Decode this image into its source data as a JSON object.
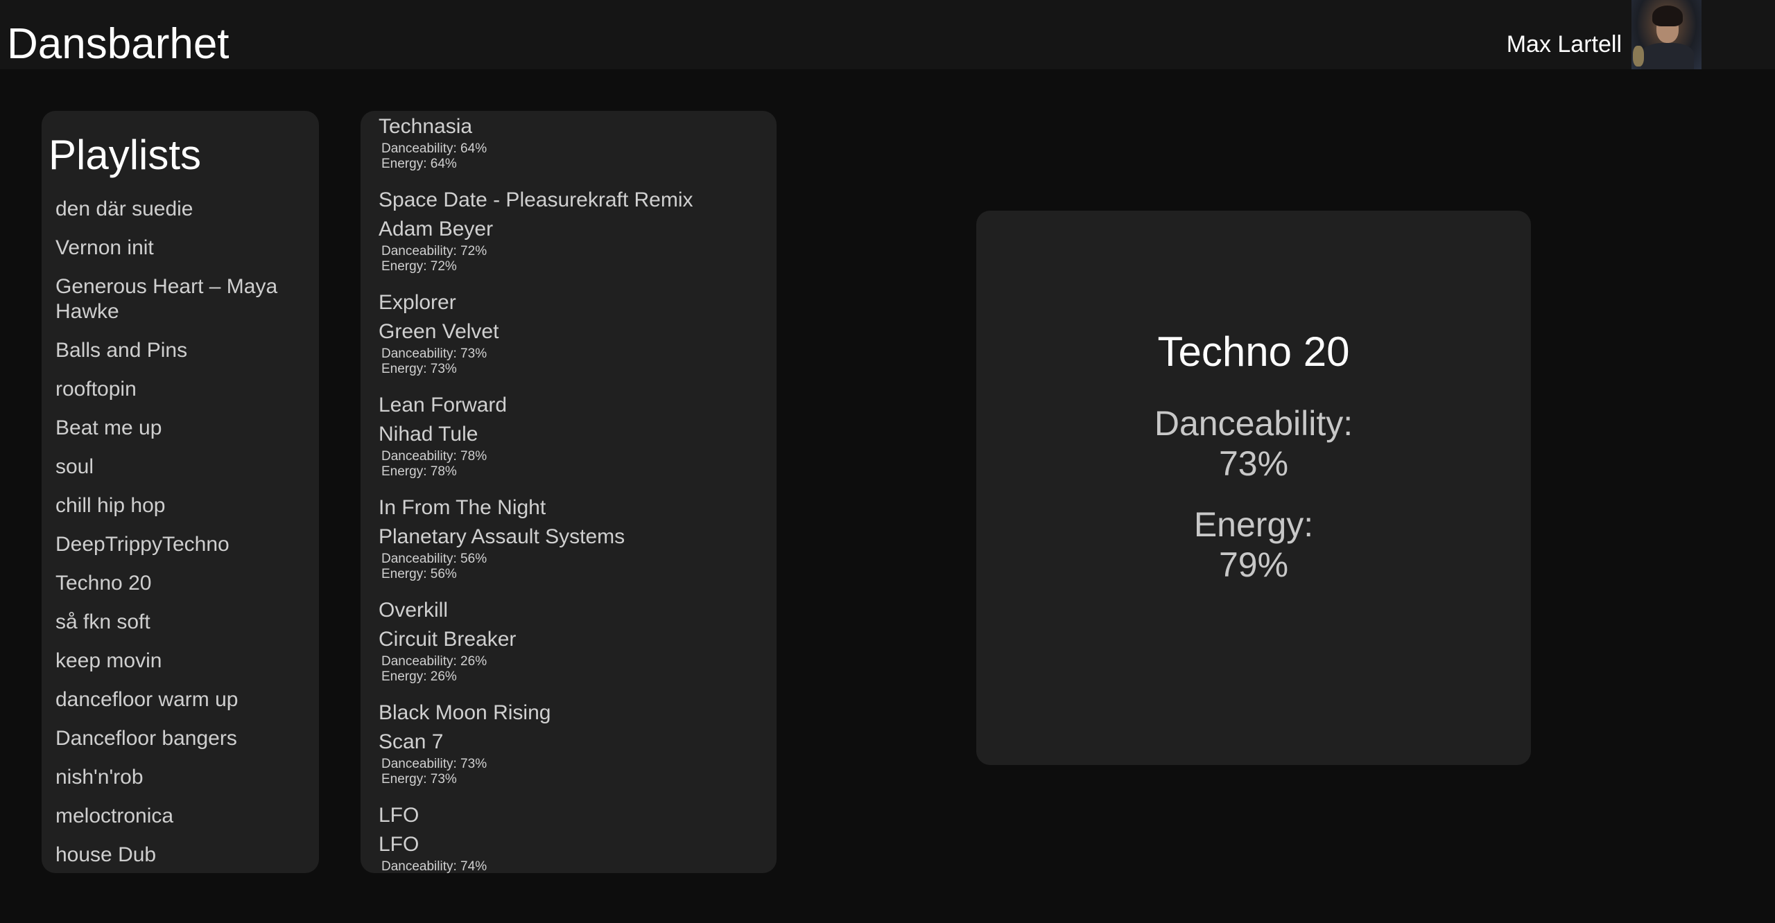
{
  "app": {
    "title": "Dansbarhet"
  },
  "user": {
    "name": "Max Lartell"
  },
  "playlists": {
    "title": "Playlists",
    "items": [
      "den där suedie",
      "Vernon init",
      "Generous Heart – Maya Hawke",
      "Balls and Pins",
      "rooftopin",
      "Beat me up",
      "soul",
      "chill hip hop",
      "DeepTrippyTechno",
      "Techno 20",
      "så fkn soft",
      "keep movin",
      "dancefloor warm up",
      "Dancefloor bangers",
      "nish'n'rob",
      "meloctronica",
      "house Dub"
    ]
  },
  "tracks": [
    {
      "artist": "Technasia",
      "danceability": "Danceability: 64%",
      "energy": "Energy: 64%"
    },
    {
      "name": "Space Date - Pleasurekraft Remix",
      "artist": "Adam Beyer",
      "danceability": "Danceability: 72%",
      "energy": "Energy: 72%"
    },
    {
      "name": "Explorer",
      "artist": "Green Velvet",
      "danceability": "Danceability: 73%",
      "energy": "Energy: 73%"
    },
    {
      "name": "Lean Forward",
      "artist": "Nihad Tule",
      "danceability": "Danceability: 78%",
      "energy": "Energy: 78%"
    },
    {
      "name": "In From The Night",
      "artist": "Planetary Assault Systems",
      "danceability": "Danceability: 56%",
      "energy": "Energy: 56%"
    },
    {
      "name": "Overkill",
      "artist": "Circuit Breaker",
      "danceability": "Danceability: 26%",
      "energy": "Energy: 26%"
    },
    {
      "name": "Black Moon Rising",
      "artist": "Scan 7",
      "danceability": "Danceability: 73%",
      "energy": "Energy: 73%"
    },
    {
      "name": "LFO",
      "artist": "LFO",
      "danceability": "Danceability: 74%",
      "energy": ""
    }
  ],
  "detail": {
    "title": "Techno 20",
    "danceability_label": "Danceability:",
    "danceability_value": "73%",
    "energy_label": "Energy:",
    "energy_value": "79%"
  }
}
